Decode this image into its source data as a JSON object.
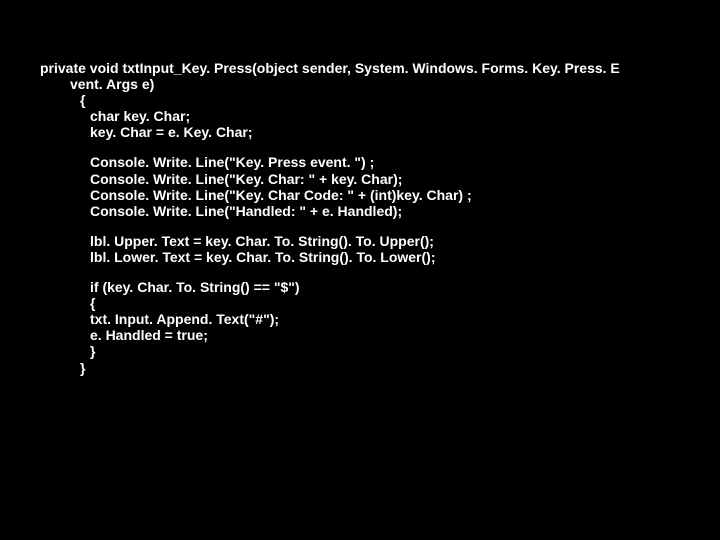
{
  "code": {
    "l1": "private void txtInput_Key. Press(object sender, System. Windows. Forms. Key. Press. E",
    "l2": "vent. Args e)",
    "l3": "{",
    "l4": "char key. Char;",
    "l5": "key. Char = e. Key. Char;",
    "l6": "Console. Write. Line(\"Key. Press event. \") ;",
    "l7": "Console. Write. Line(\"Key. Char: \" + key. Char);",
    "l8": "Console. Write. Line(\"Key. Char Code: \" + (int)key. Char) ;",
    "l9": "Console. Write. Line(\"Handled: \" + e. Handled);",
    "l10": "lbl. Upper. Text = key. Char. To. String(). To. Upper();",
    "l11": "lbl. Lower. Text = key. Char. To. String(). To. Lower();",
    "l12": "if (key. Char. To. String() == \"$\")",
    "l13": "{",
    "l14": "txt. Input. Append. Text(\"#\");",
    "l15": "e. Handled = true;",
    "l16": "}",
    "l17": "}"
  }
}
